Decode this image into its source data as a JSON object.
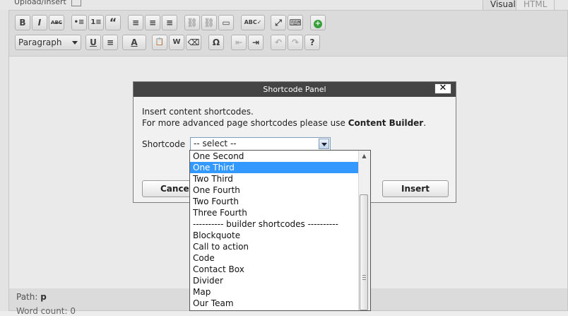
{
  "editor": {
    "upload_label": "Upload/Insert",
    "tabs": [
      "Visual",
      "HTML"
    ],
    "format_select": "Paragraph",
    "path_label": "Path:",
    "path_value": "p",
    "word_count": "Word count: 0"
  },
  "toolbar_row1": [
    "B",
    "I",
    "ABC",
    "•≡",
    "1≡",
    "“",
    "≡",
    "≡",
    "≡",
    "⛓",
    "⛓",
    "▭",
    "ABC✓",
    "⤢",
    "⌨",
    "+"
  ],
  "toolbar_row2": [
    "U",
    "≡",
    "A",
    "📋",
    "W",
    "⌫",
    "Ω",
    "⇤",
    "⇥",
    "↶",
    "↷",
    "?"
  ],
  "dialog": {
    "title": "Shortcode Panel",
    "close_label": "✕",
    "line1": "Insert content shortcodes.",
    "line2_prefix": "For more advanced page shortcodes please use ",
    "line2_bold": "Content Builder",
    "line2_suffix": ".",
    "shortcode_label": "Shortcode",
    "select_value": "-- select --",
    "cancel_label": "Cancel",
    "insert_label": "Insert"
  },
  "dropdown": {
    "selected_index": 1,
    "options": [
      "One Second",
      "One Third",
      "Two Third",
      "One Fourth",
      "Two Fourth",
      "Three Fourth",
      "---------- builder shortcodes ----------",
      "Blockquote",
      "Call to action",
      "Code",
      "Contact Box",
      "Divider",
      "Map",
      "Our Team"
    ]
  },
  "icons": {
    "upload": "upload-media-icon",
    "close": "close-icon",
    "dropdown_arrow": "chevron-down-icon",
    "scroll_up": "scroll-up-arrow-icon",
    "scroll_down": "scroll-down-arrow-icon"
  }
}
